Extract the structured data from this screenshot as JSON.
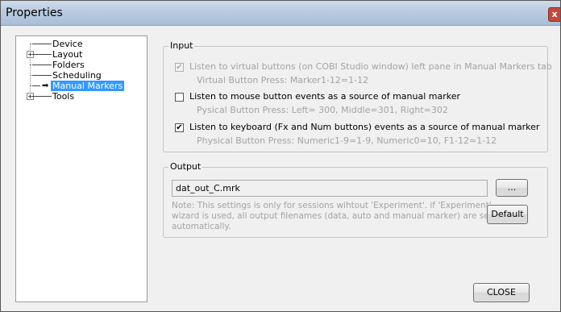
{
  "window": {
    "title": "Properties",
    "close_glyph": "x"
  },
  "tree": {
    "items": [
      {
        "label": "Device"
      },
      {
        "label": "Layout",
        "expander": "+"
      },
      {
        "label": "Folders"
      },
      {
        "label": "Scheduling"
      },
      {
        "label": "Manual Markers",
        "selected": true,
        "icon": "arrow-right-icon",
        "icon_glyph": "➡"
      },
      {
        "label": "Tools",
        "expander": "+"
      }
    ]
  },
  "input_group": {
    "title": "Input",
    "options": [
      {
        "label": "Listen to virtual buttons (on COBI Studio window) left pane in Manual Markers tab",
        "sub": "Virtual Button Press: Marker1-12=1-12",
        "checked": true,
        "enabled": false,
        "check_glyph": "✔"
      },
      {
        "label": "Listen to mouse button events as a source of manual marker",
        "sub": "Pysical Button Press: Left= 300, Middle=301, Right=302",
        "checked": false,
        "enabled": true,
        "check_glyph": ""
      },
      {
        "label": "Listen to keyboard (Fx and Num buttons)  events as a source of manual marker",
        "sub": "Physical Button Press: Numeric1-9=1-9, Numeric0=10, F1-12=1-12",
        "checked": true,
        "enabled": true,
        "check_glyph": "✔"
      }
    ]
  },
  "output_group": {
    "title": "Output",
    "filename": "dat_out_C.mrk",
    "browse_label": "...",
    "note": "Note: This settings is only for sessions wihtout 'Experiment'. if 'Experiment' wizard is used, all output filenames (data, auto and manual marker) are set automatically.",
    "default_label": "Default"
  },
  "footer": {
    "close_label": "CLOSE"
  }
}
